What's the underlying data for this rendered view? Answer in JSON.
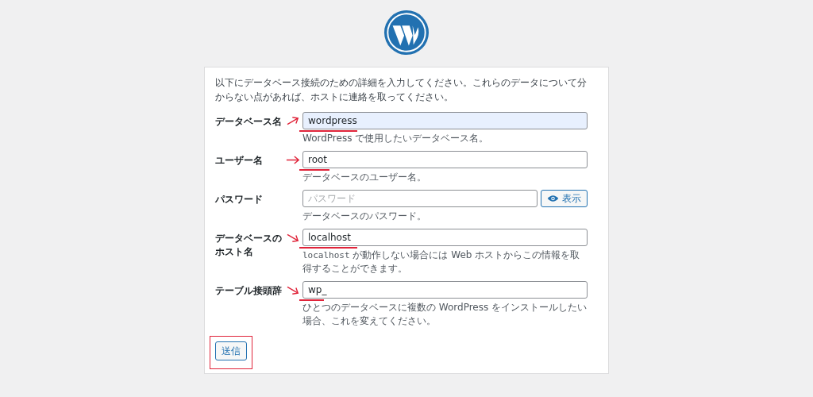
{
  "intro": "以下にデータベース接続のための詳細を入力してください。これらのデータについて分からない点があれば、ホストに連絡を取ってください。",
  "fields": [
    {
      "label": "データベース名",
      "value": "wordpress",
      "highlighted": true,
      "annotation": {
        "kind": "up"
      },
      "description": [
        {
          "kind": "text",
          "text": "WordPress で使用したいデータベース名。"
        }
      ]
    },
    {
      "label": "ユーザー名",
      "value": "root",
      "highlighted": false,
      "annotation": {
        "kind": "right"
      },
      "description": [
        {
          "kind": "text",
          "text": "データベースのユーザー名。"
        }
      ]
    },
    {
      "label": "パスワード",
      "placeholder": "パスワード",
      "highlighted": false,
      "show_button": "表示",
      "description": [
        {
          "kind": "text",
          "text": "データベースのパスワード。"
        }
      ]
    },
    {
      "label": "データベースのホスト名",
      "value": "localhost",
      "highlighted": false,
      "annotation": {
        "kind": "down"
      },
      "description": [
        {
          "kind": "code",
          "text": "localhost"
        },
        {
          "kind": "text",
          "text": " が動作しない場合には Web ホストからこの情報を取得することができます。"
        }
      ]
    },
    {
      "label": "テーブル接頭辞",
      "value": "wp_",
      "highlighted": false,
      "annotation": {
        "kind": "down"
      },
      "description": [
        {
          "kind": "text",
          "text": "ひとつのデータベースに複数の WordPress をインストールしたい場合、これを変えてください。"
        }
      ]
    }
  ],
  "submit": {
    "label": "送信",
    "marked": true
  }
}
